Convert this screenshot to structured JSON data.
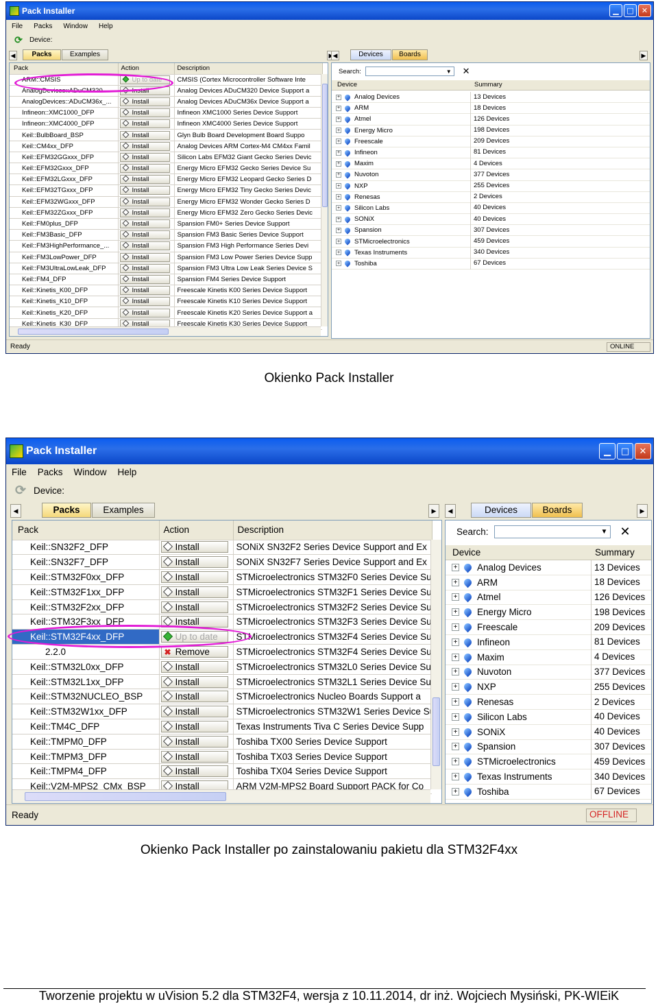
{
  "window": {
    "title": "Pack Installer",
    "menu": [
      "File",
      "Packs",
      "Window",
      "Help"
    ],
    "device_label": "Device:",
    "left_tabs": [
      "Packs",
      "Examples"
    ],
    "right_tabs": [
      "Devices",
      "Boards"
    ],
    "pack_columns": [
      "Pack",
      "Action",
      "Description"
    ],
    "search_label": "Search:",
    "device_columns": [
      "Device",
      "Summary"
    ],
    "status_left": "Ready",
    "icons": [
      "app-icon",
      "refresh-icon",
      "install-icon",
      "up-to-date-icon",
      "remove-icon",
      "expand-icon",
      "vendor-icon",
      "close-icon"
    ]
  },
  "vendors": [
    {
      "name": "Analog Devices",
      "summary": "13 Devices"
    },
    {
      "name": "ARM",
      "summary": "18 Devices"
    },
    {
      "name": "Atmel",
      "summary": "126 Devices"
    },
    {
      "name": "Energy Micro",
      "summary": "198 Devices"
    },
    {
      "name": "Freescale",
      "summary": "209 Devices"
    },
    {
      "name": "Infineon",
      "summary": "81 Devices"
    },
    {
      "name": "Maxim",
      "summary": "4 Devices"
    },
    {
      "name": "Nuvoton",
      "summary": "377 Devices"
    },
    {
      "name": "NXP",
      "summary": "255 Devices"
    },
    {
      "name": "Renesas",
      "summary": "2 Devices"
    },
    {
      "name": "Silicon Labs",
      "summary": "40 Devices"
    },
    {
      "name": "SONiX",
      "summary": "40 Devices"
    },
    {
      "name": "Spansion",
      "summary": "307 Devices"
    },
    {
      "name": "STMicroelectronics",
      "summary": "459 Devices"
    },
    {
      "name": "Texas Instruments",
      "summary": "340 Devices"
    },
    {
      "name": "Toshiba",
      "summary": "67 Devices"
    }
  ],
  "screenshot1": {
    "status_right": "ONLINE",
    "rows": [
      {
        "pack": "ARM::CMSIS",
        "action": "Up to date",
        "desc": "CMSIS (Cortex Microcontroller Software Inte"
      },
      {
        "pack": "AnalogDevices::ADuCM320",
        "action": "Install",
        "desc": "Analog Devices ADuCM320 Device Support a"
      },
      {
        "pack": "AnalogDevices::ADuCM36x_...",
        "action": "Install",
        "desc": "Analog Devices ADuCM36x Device Support a"
      },
      {
        "pack": "Infineon::XMC1000_DFP",
        "action": "Install",
        "desc": "Infineon XMC1000 Series Device Support"
      },
      {
        "pack": "Infineon::XMC4000_DFP",
        "action": "Install",
        "desc": "Infineon XMC4000 Series Device Support"
      },
      {
        "pack": "Keil::BulbBoard_BSP",
        "action": "Install",
        "desc": "Glyn Bulb Board Development Board Suppo"
      },
      {
        "pack": "Keil::CM4xx_DFP",
        "action": "Install",
        "desc": "Analog Devices ARM Cortex-M4 CM4xx Famil"
      },
      {
        "pack": "Keil::EFM32GGxxx_DFP",
        "action": "Install",
        "desc": "Silicon Labs EFM32 Giant Gecko Series Devic"
      },
      {
        "pack": "Keil::EFM32Gxxx_DFP",
        "action": "Install",
        "desc": "Energy Micro EFM32 Gecko Series Device Su"
      },
      {
        "pack": "Keil::EFM32LGxxx_DFP",
        "action": "Install",
        "desc": "Energy Micro EFM32 Leopard Gecko Series D"
      },
      {
        "pack": "Keil::EFM32TGxxx_DFP",
        "action": "Install",
        "desc": "Energy Micro EFM32 Tiny Gecko Series Devic"
      },
      {
        "pack": "Keil::EFM32WGxxx_DFP",
        "action": "Install",
        "desc": "Energy Micro EFM32 Wonder Gecko Series D"
      },
      {
        "pack": "Keil::EFM32ZGxxx_DFP",
        "action": "Install",
        "desc": "Energy Micro EFM32 Zero Gecko Series Devic"
      },
      {
        "pack": "Keil::FM0plus_DFP",
        "action": "Install",
        "desc": "Spansion FM0+ Series Device Support"
      },
      {
        "pack": "Keil::FM3Basic_DFP",
        "action": "Install",
        "desc": "Spansion FM3 Basic Series Device Support"
      },
      {
        "pack": "Keil::FM3HighPerformance_...",
        "action": "Install",
        "desc": "Spansion FM3 High Performance Series Devi"
      },
      {
        "pack": "Keil::FM3LowPower_DFP",
        "action": "Install",
        "desc": "Spansion FM3 Low Power Series Device Supp"
      },
      {
        "pack": "Keil::FM3UltraLowLeak_DFP",
        "action": "Install",
        "desc": "Spansion FM3 Ultra Low Leak Series Device S"
      },
      {
        "pack": "Keil::FM4_DFP",
        "action": "Install",
        "desc": "Spansion FM4 Series Device Support"
      },
      {
        "pack": "Keil::Kinetis_K00_DFP",
        "action": "Install",
        "desc": "Freescale Kinetis K00 Series Device Support"
      },
      {
        "pack": "Keil::Kinetis_K10_DFP",
        "action": "Install",
        "desc": "Freescale Kinetis K10 Series Device Support"
      },
      {
        "pack": "Keil::Kinetis_K20_DFP",
        "action": "Install",
        "desc": "Freescale Kinetis K20 Series Device Support a"
      },
      {
        "pack": "Keil::Kinetis_K30_DFP",
        "action": "Install",
        "desc": "Freescale Kinetis K30 Series Device Support"
      }
    ]
  },
  "caption1": "Okienko Pack Installer",
  "screenshot2": {
    "status_right": "OFFLINE",
    "rows": [
      {
        "pack": "Keil::SN32F2_DFP",
        "action": "Install",
        "desc": "SONiX SN32F2 Series Device Support and Ex"
      },
      {
        "pack": "Keil::SN32F7_DFP",
        "action": "Install",
        "desc": "SONiX SN32F7 Series Device Support and Ex"
      },
      {
        "pack": "Keil::STM32F0xx_DFP",
        "action": "Install",
        "desc": "STMicroelectronics STM32F0 Series Device Su"
      },
      {
        "pack": "Keil::STM32F1xx_DFP",
        "action": "Install",
        "desc": "STMicroelectronics STM32F1 Series Device Su"
      },
      {
        "pack": "Keil::STM32F2xx_DFP",
        "action": "Install",
        "desc": "STMicroelectronics STM32F2 Series Device Su"
      },
      {
        "pack": "Keil::STM32F3xx_DFP",
        "action": "Install",
        "desc": "STMicroelectronics STM32F3 Series Device Su"
      },
      {
        "pack": "Keil::STM32F4xx_DFP",
        "action": "Up to date",
        "desc": "STMicroelectronics STM32F4 Series Device Su"
      },
      {
        "pack": "2.2.0",
        "action": "Remove",
        "desc": "STMicroelectronics STM32F4 Series Device Su"
      },
      {
        "pack": "Keil::STM32L0xx_DFP",
        "action": "Install",
        "desc": "STMicroelectronics STM32L0 Series Device Su"
      },
      {
        "pack": "Keil::STM32L1xx_DFP",
        "action": "Install",
        "desc": "STMicroelectronics STM32L1 Series Device Su"
      },
      {
        "pack": "Keil::STM32NUCLEO_BSP",
        "action": "Install",
        "desc": "STMicroelectronics Nucleo Boards Support a"
      },
      {
        "pack": "Keil::STM32W1xx_DFP",
        "action": "Install",
        "desc": "STMicroelectronics STM32W1 Series Device Su"
      },
      {
        "pack": "Keil::TM4C_DFP",
        "action": "Install",
        "desc": "Texas Instruments Tiva C Series Device Supp"
      },
      {
        "pack": "Keil::TMPM0_DFP",
        "action": "Install",
        "desc": "Toshiba TX00 Series Device Support"
      },
      {
        "pack": "Keil::TMPM3_DFP",
        "action": "Install",
        "desc": "Toshiba TX03 Series Device Support"
      },
      {
        "pack": "Keil::TMPM4_DFP",
        "action": "Install",
        "desc": "Toshiba TX04 Series Device Support"
      },
      {
        "pack": "Keil::V2M-MPS2_CMx_BSP",
        "action": "Install",
        "desc": "ARM V2M-MPS2 Board Support PACK for Co"
      }
    ]
  },
  "caption2": "Okienko Pack Installer po zainstalowaniu pakietu dla STM32F4xx",
  "footer": "Tworzenie projektu w uVision 5.2 dla STM32F4,  wersja z 10.11.2014, dr inż. Wojciech Mysiński, PK-WIEiK"
}
